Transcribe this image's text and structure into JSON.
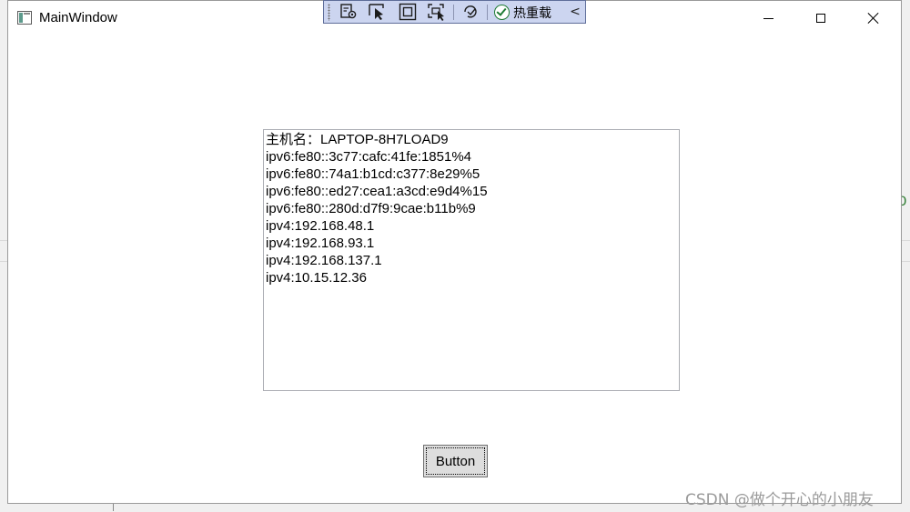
{
  "window": {
    "title": "MainWindow"
  },
  "debug_toolbar": {
    "buttons": [
      {
        "icon": "live-visual-tree-icon"
      },
      {
        "icon": "select-element-icon"
      },
      {
        "icon": "display-layout-adorners-icon"
      },
      {
        "icon": "track-focused-element-icon"
      },
      {
        "icon": "binding-failures-icon"
      }
    ],
    "hot_reload_label": "热重载",
    "collapse_glyph": "<"
  },
  "textbox": {
    "lines": [
      "主机名：LAPTOP-8H7LOAD9",
      "ipv6:fe80::3c77:cafc:41fe:1851%4",
      "ipv6:fe80::74a1:b1cd:c377:8e29%5",
      "ipv6:fe80::ed27:cea1:a3cd:e9d4%15",
      "ipv6:fe80::280d:d7f9:9cae:b11b%9",
      "ipv4:192.168.48.1",
      "ipv4:192.168.93.1",
      "ipv4:192.168.137.1",
      "ipv4:10.15.12.36"
    ]
  },
  "button": {
    "label": "Button"
  },
  "watermark": "CSDN @做个开心的小朋友",
  "colors": {
    "toolbar_bg": "#ccd5f0",
    "hot_reload_check": "#1e7b34",
    "button_bg": "#dddddd"
  }
}
